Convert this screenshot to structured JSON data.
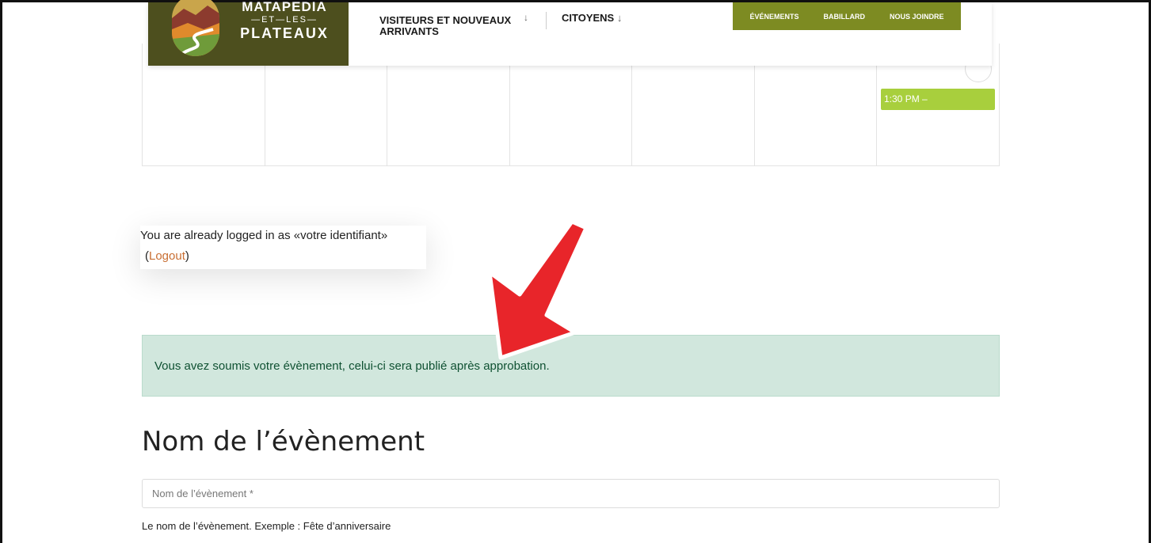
{
  "header": {
    "logo": {
      "line1": "MATAPEDIA",
      "line2": "—ET—LES—",
      "line3": "PLATEAUX"
    },
    "nav": [
      {
        "label": "VISITEURS ET NOUVEAUX ARRIVANTS",
        "arrow": "↓"
      },
      {
        "label": "CITOYENS",
        "arrow": "↓"
      }
    ],
    "topbar": [
      "ÉVÉNEMENTS",
      "BABILLARD",
      "NOUS JOINDRE"
    ]
  },
  "calendar": {
    "event_label": "1:30 PM –"
  },
  "login": {
    "text": "You are already logged in as «votre identifiant»",
    "paren_open": "(",
    "logout": "Logout",
    "paren_close": ")"
  },
  "notice": {
    "text": "Vous avez soumis votre évènement, celui-ci sera publié après approbation."
  },
  "form": {
    "title": "Nom de l’évènement",
    "name_placeholder": "Nom de l’évènement *",
    "help": "Le nom de l’évènement. Exemple : Fête d’anniversaire"
  },
  "colors": {
    "brand_dark": "#4d4f1e",
    "topbar": "#7d8b22",
    "event_green": "#a8cf3d",
    "notice_bg": "#d1e7dd",
    "notice_text": "#0f5132",
    "link": "#c86e32",
    "annotation_arrow": "#e8252a"
  }
}
